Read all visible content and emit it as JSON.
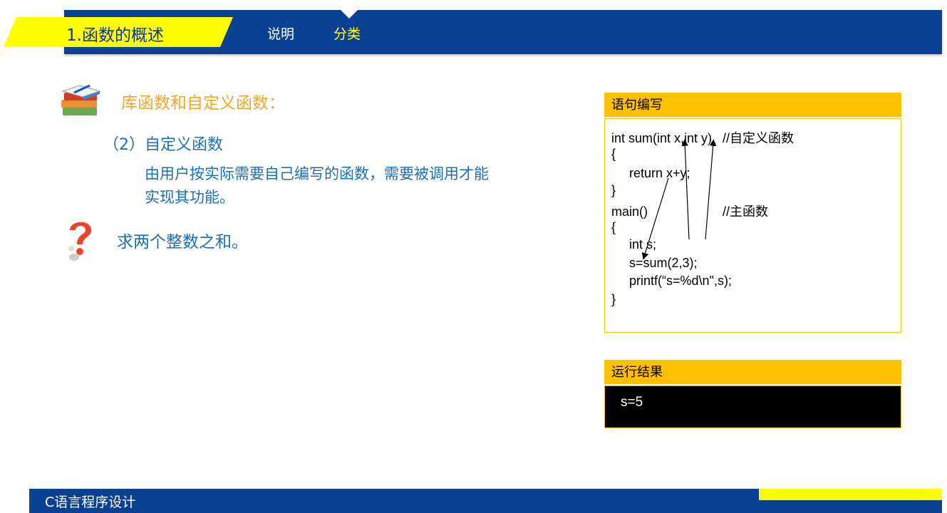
{
  "header": {
    "title": "1.函数的概述",
    "nav_items": [
      {
        "label": "说明",
        "active": false
      },
      {
        "label": "分类",
        "active": true
      }
    ]
  },
  "main": {
    "heading": "库函数和自定义函数：",
    "subheading": "（2）自定义函数",
    "description_lines": [
      "由用户按实际需要自己编写的函数，需要被调用才能",
      "实现其功能。"
    ],
    "question": "求两个整数之和。"
  },
  "code_panel": {
    "title": "语句编写",
    "lines": [
      "int sum(int x,int y)   //自定义函数",
      "{",
      "     return x+y;",
      "}",
      "main()                     //主函数",
      "{",
      "     int s;",
      "     s=sum(2,3);",
      "     printf(“s=%d\\n\",s);",
      "}"
    ]
  },
  "result_panel": {
    "title": "运行结果",
    "output": "s=5"
  },
  "footer": {
    "course": "C语言程序设计"
  },
  "colors": {
    "primary_blue": "#0b4192",
    "accent_yellow": "#ffff00",
    "panel_orange": "#ffc000",
    "text_blue": "#1c6fb5",
    "heading_orange": "#f2a526"
  },
  "icons": [
    "books-icon",
    "question-mark-icon"
  ]
}
